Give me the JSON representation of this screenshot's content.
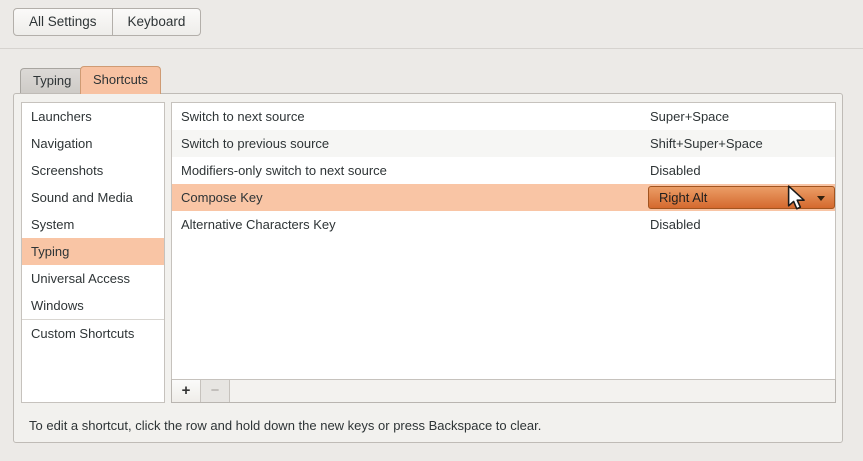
{
  "header": {
    "all_settings_label": "All Settings",
    "keyboard_label": "Keyboard"
  },
  "tabs": {
    "typing": "Typing",
    "shortcuts": "Shortcuts",
    "active_tab": "Shortcuts"
  },
  "sidebar": {
    "items": [
      "Launchers",
      "Navigation",
      "Screenshots",
      "Sound and Media",
      "System",
      "Typing",
      "Universal Access",
      "Windows"
    ],
    "selected_item": "Typing",
    "custom_item": "Custom Shortcuts"
  },
  "shortcuts_list": {
    "rows": [
      {
        "name": "Switch to next source",
        "value": "Super+Space"
      },
      {
        "name": "Switch to previous source",
        "value": "Shift+Super+Space"
      },
      {
        "name": "Modifiers-only switch to next source",
        "value": "Disabled"
      },
      {
        "name": "Compose Key",
        "value": "Right Alt",
        "selected": true,
        "control": "dropdown"
      },
      {
        "name": "Alternative Characters Key",
        "value": "Disabled"
      }
    ]
  },
  "toolbar": {
    "add_label": "+",
    "remove_label": "−",
    "remove_enabled": false
  },
  "hint": "To edit a shortcut, click the row and hold down the new keys or press Backspace to clear.",
  "colors": {
    "window_bg": "#eceae7",
    "panel_bg": "#f2f1ee",
    "selection": "#f9c5a5",
    "tab_active": "#f8c2a2",
    "dropdown_top": "#eb9d66",
    "dropdown_bottom": "#d4692e",
    "dropdown_border": "#a2541f"
  }
}
